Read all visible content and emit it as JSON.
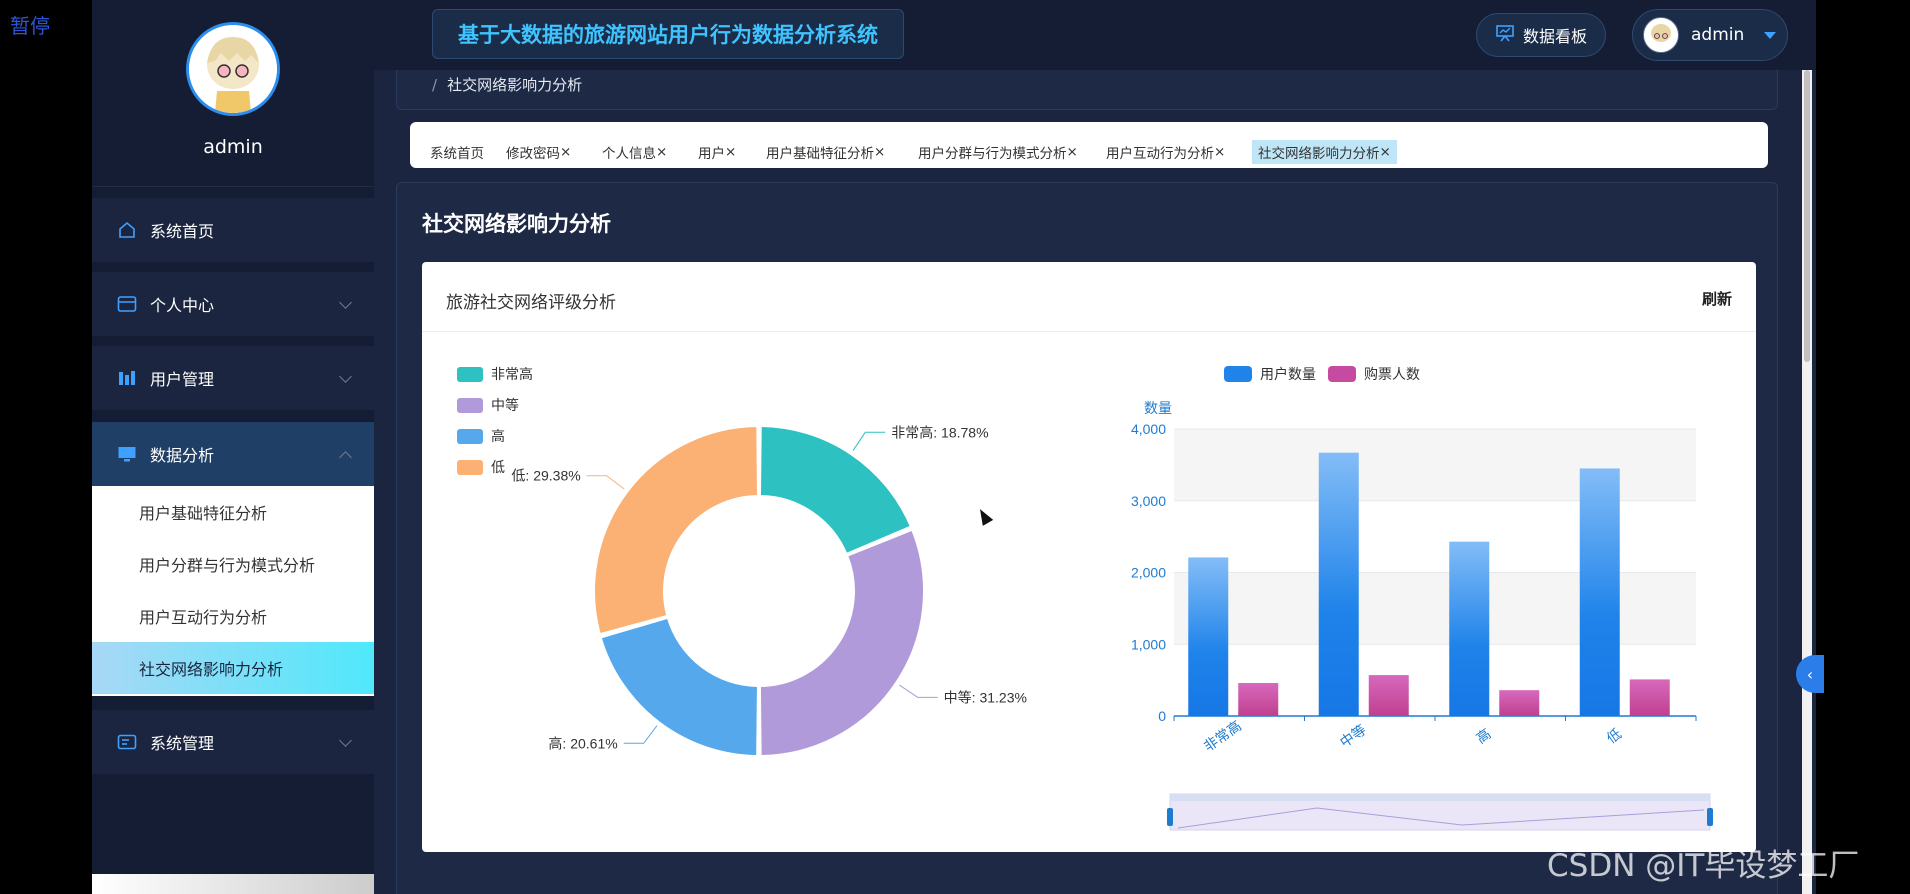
{
  "overlay": {
    "paused_label": "暂停",
    "watermark": "CSDN @IT毕设梦工厂"
  },
  "sidebar": {
    "username": "admin",
    "menus": [
      {
        "label": "系统首页",
        "icon": "home-icon"
      },
      {
        "label": "个人中心",
        "icon": "card-icon"
      },
      {
        "label": "用户管理",
        "icon": "bars-icon"
      },
      {
        "label": "数据分析",
        "icon": "monitor-icon"
      },
      {
        "label": "系统管理",
        "icon": "settings-card-icon"
      }
    ],
    "submenu": [
      "用户基础特征分析",
      "用户分群与行为模式分析",
      "用户互动行为分析",
      "社交网络影响力分析"
    ]
  },
  "header": {
    "system_title": "基于大数据的旅游网站用户行为数据分析系统",
    "dashboard_label": "数据看板",
    "user_label": "admin"
  },
  "breadcrumb": {
    "separator": "/",
    "current": "社交网络影响力分析"
  },
  "tabs": [
    "系统首页",
    "修改密码",
    "个人信息",
    "用户",
    "用户基础特征分析",
    "用户分群与行为模式分析",
    "用户互动行为分析",
    "社交网络影响力分析"
  ],
  "tab_close": "×",
  "main": {
    "page_title": "社交网络影响力分析",
    "card_title": "旅游社交网络评级分析",
    "refresh_label": "刷新"
  },
  "chart_data": [
    {
      "type": "pie",
      "style": "donut",
      "legend_position": "top-left",
      "slices": [
        {
          "label": "非常高",
          "percent": 18.78,
          "color": "#2ec1c1"
        },
        {
          "label": "中等",
          "percent": 31.23,
          "color": "#b09ad9"
        },
        {
          "label": "高",
          "percent": 20.61,
          "color": "#55a8eb"
        },
        {
          "label": "低",
          "percent": 29.38,
          "color": "#fbb174"
        }
      ]
    },
    {
      "type": "bar",
      "legend_position": "top-center",
      "ylabel": "数量",
      "ylim": [
        0,
        4000
      ],
      "yticks": [
        "0",
        "1,000",
        "2,000",
        "3,000",
        "4,000"
      ],
      "categories": [
        "非常高",
        "中等",
        "高",
        "低"
      ],
      "series": [
        {
          "name": "用户数量",
          "values": [
            2210,
            3670,
            2430,
            3450
          ],
          "color": "#1f83ea"
        },
        {
          "name": "购票人数",
          "values": [
            460,
            570,
            360,
            510
          ],
          "color": "#c64aa0"
        }
      ],
      "datazoom": true
    }
  ]
}
